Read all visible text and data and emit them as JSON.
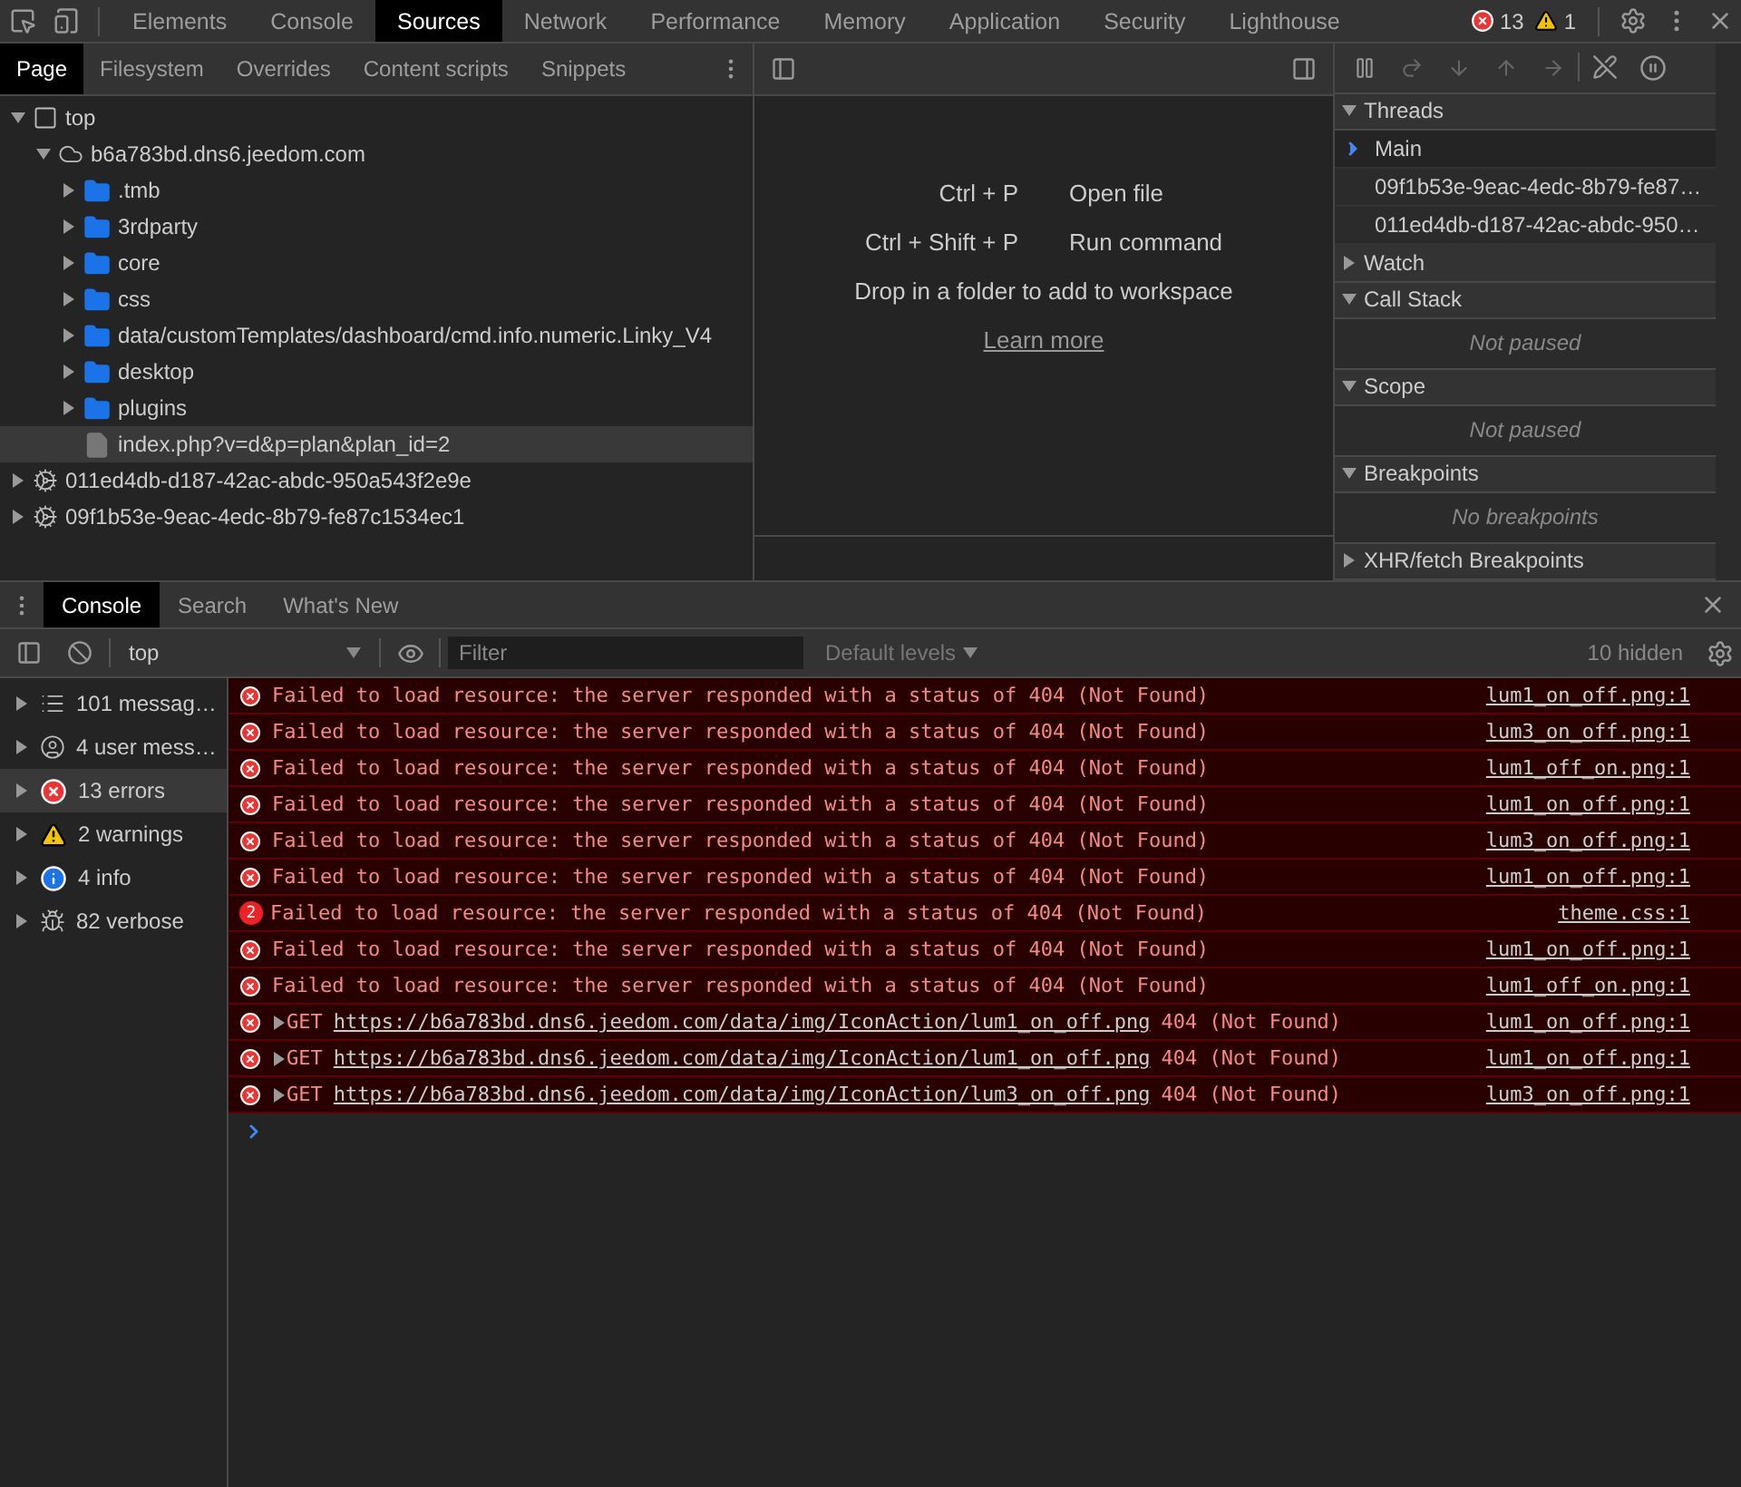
{
  "main_tabs": [
    {
      "label": "Elements",
      "selected": false
    },
    {
      "label": "Console",
      "selected": false
    },
    {
      "label": "Sources",
      "selected": true
    },
    {
      "label": "Network",
      "selected": false
    },
    {
      "label": "Performance",
      "selected": false
    },
    {
      "label": "Memory",
      "selected": false
    },
    {
      "label": "Application",
      "selected": false
    },
    {
      "label": "Security",
      "selected": false
    },
    {
      "label": "Lighthouse",
      "selected": false
    }
  ],
  "counts": {
    "errors": "13",
    "warnings": "1"
  },
  "navigator_tabs": [
    {
      "label": "Page",
      "selected": true
    },
    {
      "label": "Filesystem",
      "selected": false
    },
    {
      "label": "Overrides",
      "selected": false
    },
    {
      "label": "Content scripts",
      "selected": false
    },
    {
      "label": "Snippets",
      "selected": false
    }
  ],
  "tree": [
    {
      "kind": "frame",
      "label": "top",
      "expanded": true,
      "selected": false,
      "children": [
        {
          "kind": "domain",
          "label": "b6a783bd.dns6.jeedom.com",
          "expanded": true,
          "selected": false,
          "children": [
            {
              "kind": "folder",
              "label": ".tmb",
              "expanded": false,
              "selected": false
            },
            {
              "kind": "folder",
              "label": "3rdparty",
              "expanded": false,
              "selected": false
            },
            {
              "kind": "folder",
              "label": "core",
              "expanded": false,
              "selected": false
            },
            {
              "kind": "folder",
              "label": "css",
              "expanded": false,
              "selected": false
            },
            {
              "kind": "folder",
              "label": "data/customTemplates/dashboard/cmd.info.numeric.Linky_V4",
              "expanded": false,
              "selected": false
            },
            {
              "kind": "folder",
              "label": "desktop",
              "expanded": false,
              "selected": false
            },
            {
              "kind": "folder",
              "label": "plugins",
              "expanded": false,
              "selected": false
            },
            {
              "kind": "file",
              "label": "index.php?v=d&p=plan&plan_id=2",
              "selected": true
            }
          ]
        }
      ]
    },
    {
      "kind": "worker",
      "label": "011ed4db-d187-42ac-abdc-950a543f2e9e",
      "expanded": false,
      "selected": false
    },
    {
      "kind": "worker",
      "label": "09f1b53e-9eac-4edc-8b79-fe87c1534ec1",
      "expanded": false,
      "selected": false
    }
  ],
  "editor_hints": [
    {
      "keys": "Ctrl + P",
      "action": "Open file"
    },
    {
      "keys": "Ctrl + Shift + P",
      "action": "Run command"
    }
  ],
  "editor_drop_text": "Drop in a folder to add to workspace",
  "editor_link": "Learn more",
  "debugger": {
    "threads": {
      "title": "Threads",
      "expanded": true,
      "items": [
        {
          "label": "Main",
          "selected": true
        },
        {
          "label": "09f1b53e-9eac-4edc-8b79-fe87…",
          "selected": false
        },
        {
          "label": "011ed4db-d187-42ac-abdc-950…",
          "selected": false
        }
      ]
    },
    "sections": [
      {
        "title": "Watch",
        "expanded": false
      },
      {
        "title": "Call Stack",
        "expanded": true,
        "empty": "Not paused"
      },
      {
        "title": "Scope",
        "expanded": true,
        "empty": "Not paused"
      },
      {
        "title": "Breakpoints",
        "expanded": true,
        "empty": "No breakpoints"
      },
      {
        "title": "XHR/fetch Breakpoints",
        "expanded": false
      }
    ]
  },
  "drawer_tabs": [
    {
      "label": "Console",
      "selected": true
    },
    {
      "label": "Search",
      "selected": false
    },
    {
      "label": "What's New",
      "selected": false
    }
  ],
  "console_toolbar": {
    "context": "top",
    "filter_placeholder": "Filter",
    "levels": "Default levels",
    "hidden": "10 hidden"
  },
  "console_sidebar": [
    {
      "kind": "messages",
      "label": "101 messag…",
      "selected": false
    },
    {
      "kind": "user",
      "label": "4 user mess…",
      "selected": false
    },
    {
      "kind": "errors",
      "label": "13 errors",
      "selected": true
    },
    {
      "kind": "warnings",
      "label": "2 warnings",
      "selected": false
    },
    {
      "kind": "info",
      "label": "4 info",
      "selected": false
    },
    {
      "kind": "verbose",
      "label": "82 verbose",
      "selected": false
    }
  ],
  "messages": [
    {
      "kind": "error",
      "text": "Failed to load resource: the server responded with a status of 404 (Not Found)",
      "source": "lum1_on_off.png:1"
    },
    {
      "kind": "error",
      "text": "Failed to load resource: the server responded with a status of 404 (Not Found)",
      "source": "lum3_on_off.png:1"
    },
    {
      "kind": "error",
      "text": "Failed to load resource: the server responded with a status of 404 (Not Found)",
      "source": "lum1_off_on.png:1"
    },
    {
      "kind": "error",
      "text": "Failed to load resource: the server responded with a status of 404 (Not Found)",
      "source": "lum1_on_off.png:1"
    },
    {
      "kind": "error",
      "text": "Failed to load resource: the server responded with a status of 404 (Not Found)",
      "source": "lum3_on_off.png:1"
    },
    {
      "kind": "error",
      "text": "Failed to load resource: the server responded with a status of 404 (Not Found)",
      "source": "lum1_on_off.png:1"
    },
    {
      "kind": "repeated",
      "count": "2",
      "text": "Failed to load resource: the server responded with a status of 404 (Not Found)",
      "source": "theme.css:1"
    },
    {
      "kind": "error",
      "text": "Failed to load resource: the server responded with a status of 404 (Not Found)",
      "source": "lum1_on_off.png:1"
    },
    {
      "kind": "error",
      "text": "Failed to load resource: the server responded with a status of 404 (Not Found)",
      "source": "lum1_off_on.png:1"
    },
    {
      "kind": "request",
      "method": "GET",
      "url": "https://b6a783bd.dns6.jeedom.com/data/img/IconAction/lum1_on_off.png",
      "text": "404 (Not Found)",
      "source": "lum1_on_off.png:1"
    },
    {
      "kind": "request",
      "method": "GET",
      "url": "https://b6a783bd.dns6.jeedom.com/data/img/IconAction/lum1_on_off.png",
      "text": "404 (Not Found)",
      "source": "lum1_on_off.png:1"
    },
    {
      "kind": "request",
      "method": "GET",
      "url": "https://b6a783bd.dns6.jeedom.com/data/img/IconAction/lum3_on_off.png",
      "text": "404 (Not Found)",
      "source": "lum3_on_off.png:1"
    }
  ]
}
